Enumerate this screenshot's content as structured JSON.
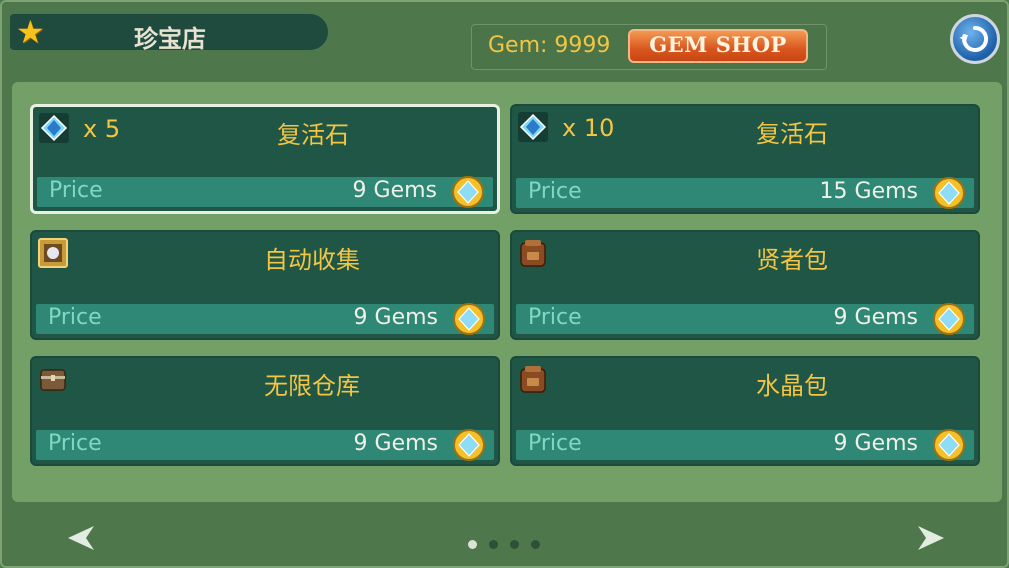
{
  "header": {
    "title": "珍宝店",
    "gem_display": "Gem: 9999",
    "gem_shop_label": "GEM SHOP"
  },
  "items": [
    {
      "icon": "gem-crystal-icon",
      "qty": "x 5",
      "name": "复活石",
      "price_label": "Price",
      "price": "9 Gems",
      "selected": true
    },
    {
      "icon": "gem-crystal-icon",
      "qty": "x 10",
      "name": "复活石",
      "price_label": "Price",
      "price": "15 Gems",
      "selected": false
    },
    {
      "icon": "auto-collect-icon",
      "qty": "",
      "name": "自动收集",
      "price_label": "Price",
      "price": "9 Gems",
      "selected": false
    },
    {
      "icon": "backpack-icon",
      "qty": "",
      "name": "贤者包",
      "price_label": "Price",
      "price": "9 Gems",
      "selected": false
    },
    {
      "icon": "chest-icon",
      "qty": "",
      "name": "无限仓库",
      "price_label": "Price",
      "price": "9 Gems",
      "selected": false
    },
    {
      "icon": "backpack-icon",
      "qty": "",
      "name": "水晶包",
      "price_label": "Price",
      "price": "9 Gems",
      "selected": false
    }
  ],
  "pagination": {
    "pages": 4,
    "current_page": 1
  },
  "colors": {
    "accent_gold": "#f3c543",
    "card_bg": "#1f5646",
    "price_bar": "#2f8875",
    "gem_shop_orange": "#d9561f"
  }
}
